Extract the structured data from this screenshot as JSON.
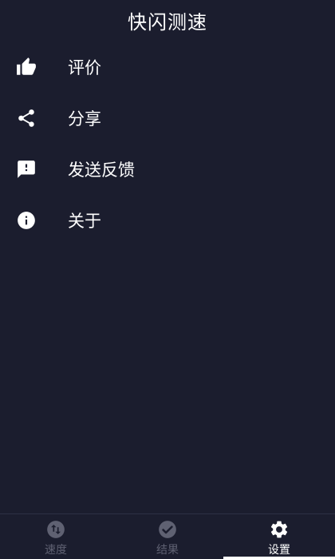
{
  "app": {
    "title": "快闪测速"
  },
  "menu": {
    "items": [
      {
        "label": "评价",
        "icon": "thumb-up-icon"
      },
      {
        "label": "分享",
        "icon": "share-icon"
      },
      {
        "label": "发送反馈",
        "icon": "feedback-icon"
      },
      {
        "label": "关于",
        "icon": "info-icon"
      }
    ]
  },
  "bottom_nav": {
    "tabs": [
      {
        "label": "速度",
        "icon": "swap-vertical-icon",
        "active": false
      },
      {
        "label": "结果",
        "icon": "check-circle-icon",
        "active": false
      },
      {
        "label": "设置",
        "icon": "gear-icon",
        "active": true
      }
    ]
  },
  "colors": {
    "background": "#1b1d2e",
    "text": "#ffffff",
    "inactive": "#5f6172"
  }
}
